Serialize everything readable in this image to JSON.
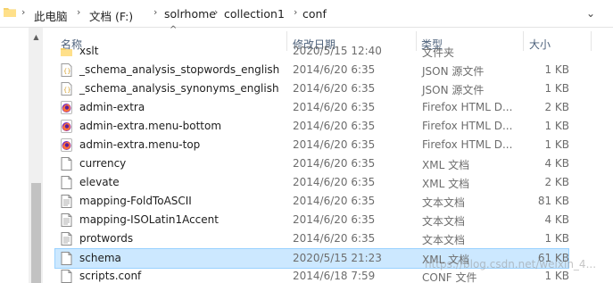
{
  "breadcrumb": [
    "此电脑",
    "文档 (F:)",
    "solrhome",
    "collection1",
    "conf"
  ],
  "columns": {
    "name": "名称",
    "date": "修改日期",
    "type": "类型",
    "size": "大小"
  },
  "files": [
    {
      "icon": "folder-icon",
      "name": "xslt",
      "date": "2020/5/15 12:40",
      "type": "文件夹",
      "size": ""
    },
    {
      "icon": "json-file-icon",
      "name": "_schema_analysis_stopwords_english",
      "date": "2014/6/20 6:35",
      "type": "JSON 源文件",
      "size": "1 KB"
    },
    {
      "icon": "json-file-icon",
      "name": "_schema_analysis_synonyms_english",
      "date": "2014/6/20 6:35",
      "type": "JSON 源文件",
      "size": "1 KB"
    },
    {
      "icon": "firefox-html-icon",
      "name": "admin-extra",
      "date": "2014/6/20 6:35",
      "type": "Firefox HTML D...",
      "size": "2 KB"
    },
    {
      "icon": "firefox-html-icon",
      "name": "admin-extra.menu-bottom",
      "date": "2014/6/20 6:35",
      "type": "Firefox HTML D...",
      "size": "1 KB"
    },
    {
      "icon": "firefox-html-icon",
      "name": "admin-extra.menu-top",
      "date": "2014/6/20 6:35",
      "type": "Firefox HTML D...",
      "size": "1 KB"
    },
    {
      "icon": "xml-file-icon",
      "name": "currency",
      "date": "2014/6/20 6:35",
      "type": "XML 文档",
      "size": "4 KB"
    },
    {
      "icon": "xml-file-icon",
      "name": "elevate",
      "date": "2014/6/20 6:35",
      "type": "XML 文档",
      "size": "2 KB"
    },
    {
      "icon": "text-file-icon",
      "name": "mapping-FoldToASCII",
      "date": "2014/6/20 6:35",
      "type": "文本文档",
      "size": "81 KB"
    },
    {
      "icon": "text-file-icon",
      "name": "mapping-ISOLatin1Accent",
      "date": "2014/6/20 6:35",
      "type": "文本文档",
      "size": "4 KB"
    },
    {
      "icon": "text-file-icon",
      "name": "protwords",
      "date": "2014/6/20 6:35",
      "type": "文本文档",
      "size": "1 KB"
    },
    {
      "icon": "xml-file-icon",
      "name": "schema",
      "date": "2020/5/15 21:23",
      "type": "XML 文档",
      "size": "61 KB",
      "selected": true
    },
    {
      "icon": "conf-file-icon",
      "name": "scripts.conf",
      "date": "2014/6/18 7:59",
      "type": "CONF 文件",
      "size": "1 KB"
    }
  ],
  "watermark": "https://blog.csdn.net/weixin_4..."
}
